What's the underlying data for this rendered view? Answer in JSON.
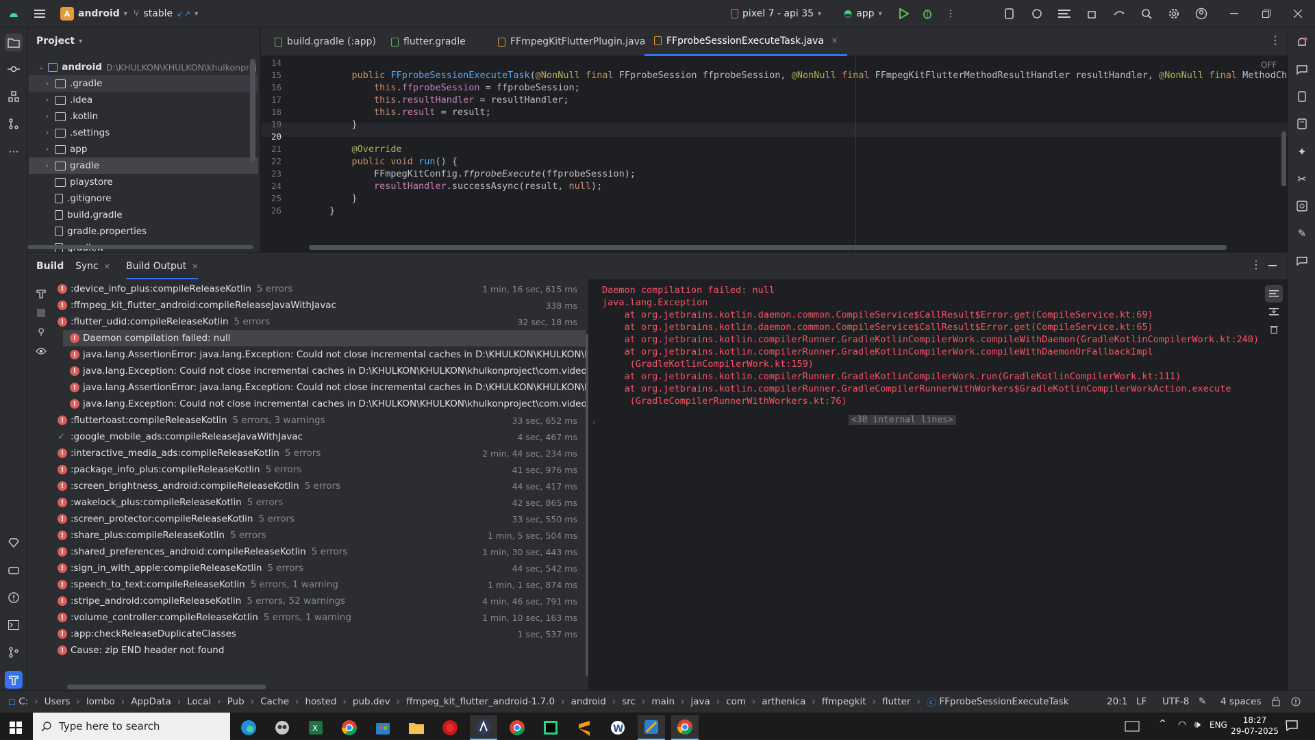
{
  "titlebar": {
    "project_badge": "A",
    "project_name": "android",
    "vcs_branch": "stable",
    "device": "pixel 7 - api 35",
    "run_config": "app"
  },
  "project_panel": {
    "title": "Project",
    "root_name": "android",
    "root_path": "D:\\KHULKON\\KHULKON\\khulkonproj",
    "items": [
      {
        "label": ".gradle",
        "kind": "folder"
      },
      {
        "label": ".idea",
        "kind": "folder"
      },
      {
        "label": ".kotlin",
        "kind": "folder"
      },
      {
        "label": ".settings",
        "kind": "folder"
      },
      {
        "label": "app",
        "kind": "folder"
      },
      {
        "label": "gradle",
        "kind": "folder"
      },
      {
        "label": "playstore",
        "kind": "folder"
      },
      {
        "label": ".gitignore",
        "kind": "file"
      },
      {
        "label": "build.gradle",
        "kind": "file"
      },
      {
        "label": "gradle.properties",
        "kind": "file"
      },
      {
        "label": "gradlew",
        "kind": "file"
      }
    ]
  },
  "editor": {
    "tabs": [
      {
        "label": "build.gradle (:app)"
      },
      {
        "label": "flutter.gradle"
      },
      {
        "label": "FFmpegKitFlutterPlugin.java"
      },
      {
        "label": "FFprobeSessionExecuteTask.java",
        "active": true
      }
    ],
    "inlay_status": "OFF",
    "line_numbers": [
      "14",
      "15",
      "16",
      "17",
      "18",
      "19",
      "20",
      "21",
      "22",
      "23",
      "24",
      "25",
      "26"
    ],
    "current_line": "20"
  },
  "build_panel": {
    "tabs": [
      "Build",
      "Sync",
      "Build Output"
    ],
    "active_tab": "Build Output",
    "tasks": [
      {
        "label": ":device_info_plus:compileReleaseKotlin",
        "count": "5 errors",
        "time": "1 min, 16 sec, 615 ms",
        "status": "error"
      },
      {
        "label": ":ffmpeg_kit_flutter_android:compileReleaseJavaWithJavac",
        "count": "",
        "time": "338 ms",
        "status": "error"
      },
      {
        "label": ":flutter_udid:compileReleaseKotlin",
        "count": "5 errors",
        "time": "32 sec, 18 ms",
        "status": "error"
      },
      {
        "label": "Daemon compilation failed: null",
        "count": "",
        "time": "",
        "status": "error",
        "indent": 1,
        "selected": true
      },
      {
        "label": "java.lang.AssertionError: java.lang.Exception: Could not close incremental caches in D:\\KHULKON\\KHULKON\\khulkonpr",
        "count": "",
        "time": "",
        "status": "error",
        "indent": 1
      },
      {
        "label": "java.lang.Exception: Could not close incremental caches in D:\\KHULKON\\KHULKON\\khulkonproject\\com.video.khulkont",
        "count": "",
        "time": "",
        "status": "error",
        "indent": 1
      },
      {
        "label": "java.lang.AssertionError: java.lang.Exception: Could not close incremental caches in D:\\KHULKON\\KHULKON\\khulkonpr",
        "count": "",
        "time": "",
        "status": "error",
        "indent": 1
      },
      {
        "label": "java.lang.Exception: Could not close incremental caches in D:\\KHULKON\\KHULKON\\khulkonproject\\com.video.khulkont",
        "count": "",
        "time": "",
        "status": "error",
        "indent": 1
      },
      {
        "label": ":fluttertoast:compileReleaseKotlin",
        "count": "5 errors, 3 warnings",
        "time": "33 sec, 652 ms",
        "status": "error"
      },
      {
        "label": ":google_mobile_ads:compileReleaseJavaWithJavac",
        "count": "",
        "time": "4 sec, 467 ms",
        "status": "ok"
      },
      {
        "label": ":interactive_media_ads:compileReleaseKotlin",
        "count": "5 errors",
        "time": "2 min, 44 sec, 234 ms",
        "status": "error"
      },
      {
        "label": ":package_info_plus:compileReleaseKotlin",
        "count": "5 errors",
        "time": "41 sec, 976 ms",
        "status": "error"
      },
      {
        "label": ":screen_brightness_android:compileReleaseKotlin",
        "count": "5 errors",
        "time": "44 sec, 417 ms",
        "status": "error"
      },
      {
        "label": ":wakelock_plus:compileReleaseKotlin",
        "count": "5 errors",
        "time": "42 sec, 865 ms",
        "status": "error"
      },
      {
        "label": ":screen_protector:compileReleaseKotlin",
        "count": "5 errors",
        "time": "33 sec, 550 ms",
        "status": "error"
      },
      {
        "label": ":share_plus:compileReleaseKotlin",
        "count": "5 errors",
        "time": "1 min, 5 sec, 504 ms",
        "status": "error"
      },
      {
        "label": ":shared_preferences_android:compileReleaseKotlin",
        "count": "5 errors",
        "time": "1 min, 30 sec, 443 ms",
        "status": "error"
      },
      {
        "label": ":sign_in_with_apple:compileReleaseKotlin",
        "count": "5 errors",
        "time": "44 sec, 542 ms",
        "status": "error"
      },
      {
        "label": ":speech_to_text:compileReleaseKotlin",
        "count": "5 errors, 1 warning",
        "time": "1 min, 1 sec, 874 ms",
        "status": "error"
      },
      {
        "label": ":stripe_android:compileReleaseKotlin",
        "count": "5 errors, 52 warnings",
        "time": "4 min, 46 sec, 791 ms",
        "status": "error"
      },
      {
        "label": ":volume_controller:compileReleaseKotlin",
        "count": "5 errors, 1 warning",
        "time": "1 min, 10 sec, 163 ms",
        "status": "error"
      },
      {
        "label": ":app:checkReleaseDuplicateClasses",
        "count": "",
        "time": "1 sec, 537 ms",
        "status": "error"
      },
      {
        "label": "Cause: zip END header not found",
        "count": "",
        "time": "",
        "status": "error"
      }
    ],
    "console_lines": [
      "Daemon compilation failed: null",
      "java.lang.Exception",
      "    at org.jetbrains.kotlin.daemon.common.CompileService$CallResult$Error.get(CompileService.kt:69)",
      "    at org.jetbrains.kotlin.daemon.common.CompileService$CallResult$Error.get(CompileService.kt:65)",
      "    at org.jetbrains.kotlin.compilerRunner.GradleKotlinCompilerWork.compileWithDaemon(GradleKotlinCompilerWork.kt:240)",
      "    at org.jetbrains.kotlin.compilerRunner.GradleKotlinCompilerWork.compileWithDaemonOrFallbackImpl",
      "     (GradleKotlinCompilerWork.kt:159)",
      "    at org.jetbrains.kotlin.compilerRunner.GradleKotlinCompilerWork.run(GradleKotlinCompilerWork.kt:111)",
      "    at org.jetbrains.kotlin.compilerRunner.GradleCompilerRunnerWithWorkers$GradleKotlinCompilerWorkAction.execute",
      "     (GradleCompilerRunnerWithWorkers.kt:76)"
    ],
    "internal_lines": "<30 internal lines>"
  },
  "statusbar": {
    "breadcrumbs": [
      "C:",
      "Users",
      "lombo",
      "AppData",
      "Local",
      "Pub",
      "Cache",
      "hosted",
      "pub.dev",
      "ffmpeg_kit_flutter_android-1.7.0",
      "android",
      "src",
      "main",
      "java",
      "com",
      "arthenica",
      "ffmpegkit",
      "flutter",
      "FFprobeSessionExecuteTask"
    ],
    "position": "20:1",
    "line_sep": "LF",
    "encoding": "UTF-8",
    "indent": "4 spaces"
  },
  "taskbar": {
    "search_placeholder": "Type here to search",
    "language": "ENG",
    "time": "18:27",
    "date": "29-07-2025"
  },
  "colors": {
    "accent": "#3574f0",
    "error": "#db5c5c",
    "console_error": "#f75464",
    "success": "#5fb865"
  }
}
